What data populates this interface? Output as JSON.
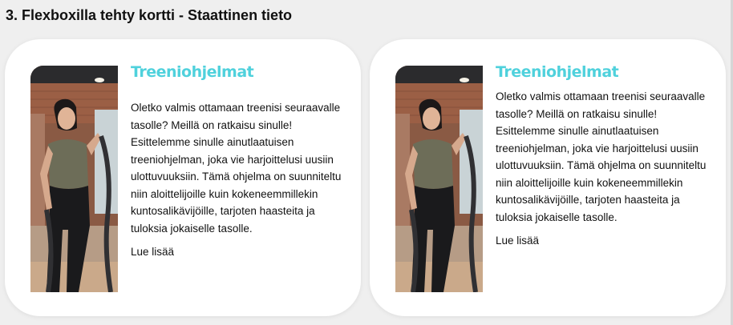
{
  "page": {
    "title": "3. Flexboxilla tehty kortti - Staattinen tieto"
  },
  "cards": [
    {
      "image_alt": "Nainen treenaa taisteluköysillä kuntosalilla",
      "heading": "Treeniohjelmat",
      "text": "Oletko valmis ottamaan treenisi seuraavalle tasolle? Meillä on ratkaisu sinulle! Esittelemme sinulle ainutlaatuisen treeniohjelman, joka vie harjoittelusi uusiin ulottuvuuksiin. Tämä ohjelma on suunniteltu niin aloittelijoille kuin kokeneemmillekin kuntosalikävijöille, tarjoten haasteita ja tuloksia jokaiselle tasolle.",
      "link": "Lue lisää"
    },
    {
      "image_alt": "Nainen treenaa taisteluköysillä kuntosalilla",
      "heading": "Treeniohjelmat",
      "text": "Oletko valmis ottamaan treenisi seuraavalle tasolle? Meillä on ratkaisu sinulle! Esittelemme sinulle ainutlaatuisen treeniohjelman, joka vie harjoittelusi uusiin ulottuvuuksiin. Tämä ohjelma on suunniteltu niin aloittelijoille kuin kokeneemmillekin kuntosalikävijöille, tarjoten haasteita ja tuloksia jokaiselle tasolle.",
      "link": "Lue lisää"
    }
  ],
  "colors": {
    "heading_accent": "#4fd1dc",
    "card_background": "#ffffff",
    "page_background": "#efefef"
  }
}
